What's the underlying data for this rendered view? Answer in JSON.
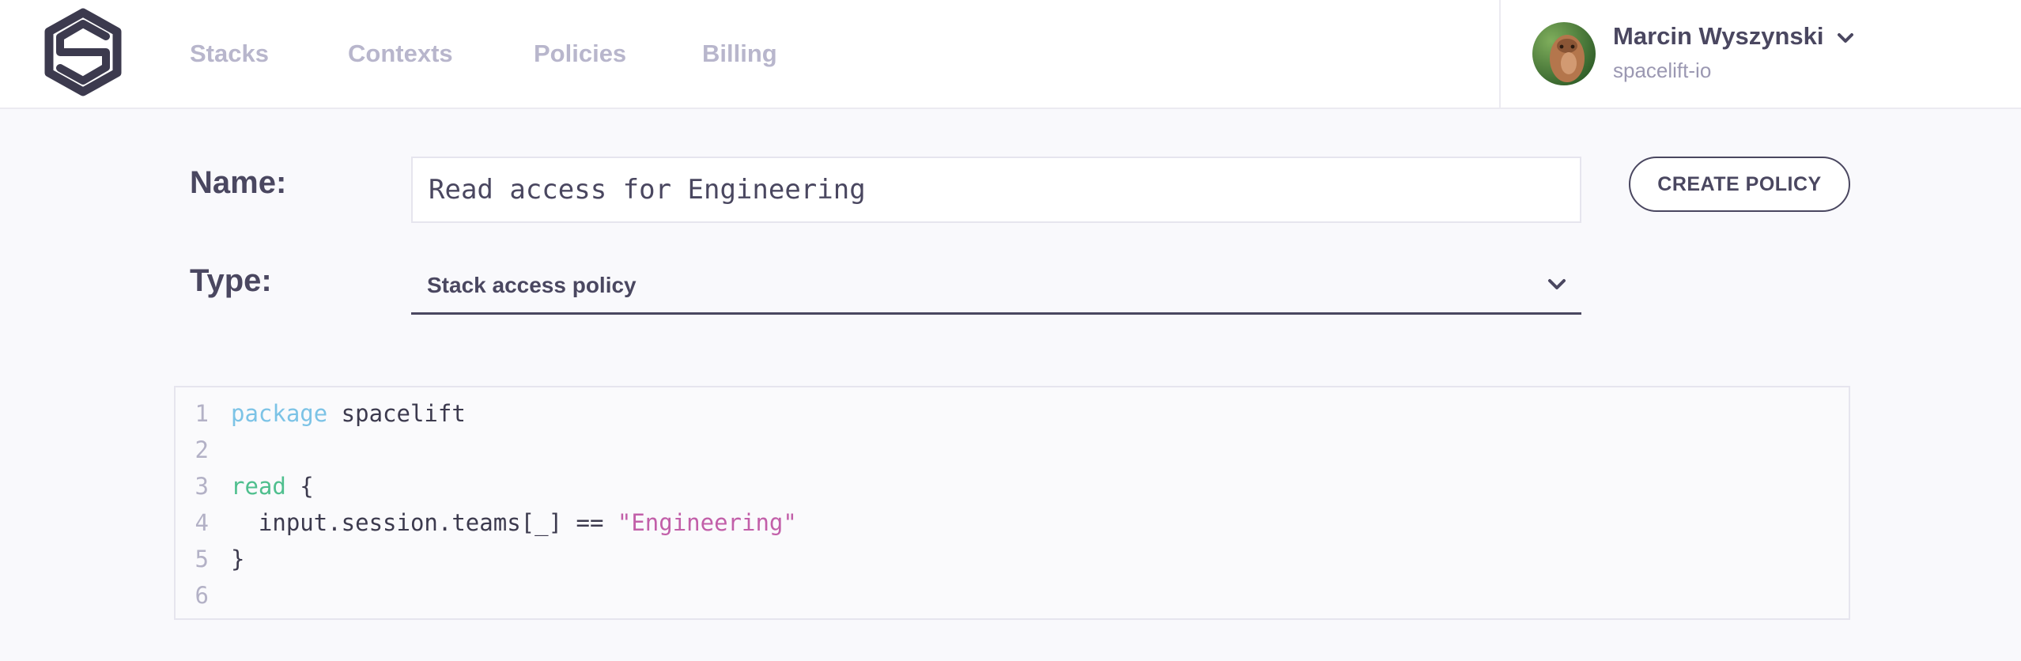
{
  "nav": {
    "items": [
      {
        "label": "Stacks"
      },
      {
        "label": "Contexts"
      },
      {
        "label": "Policies"
      },
      {
        "label": "Billing"
      }
    ]
  },
  "user": {
    "name": "Marcin Wyszynski",
    "org": "spacelift-io"
  },
  "form": {
    "name_label": "Name:",
    "name_value": "Read access for Engineering",
    "type_label": "Type:",
    "type_value": "Stack access policy",
    "create_button": "CREATE POLICY"
  },
  "editor": {
    "lines": [
      {
        "number": "1",
        "tokens": [
          {
            "t": "package",
            "k": "keyword"
          },
          {
            "t": " spacelift",
            "k": "plain"
          }
        ]
      },
      {
        "number": "2",
        "tokens": []
      },
      {
        "number": "3",
        "tokens": [
          {
            "t": "read",
            "k": "rule"
          },
          {
            "t": " {",
            "k": "plain"
          }
        ]
      },
      {
        "number": "4",
        "tokens": [
          {
            "t": "  input.session.teams[_] == ",
            "k": "plain"
          },
          {
            "t": "\"Engineering\"",
            "k": "string"
          }
        ]
      },
      {
        "number": "5",
        "tokens": [
          {
            "t": "}",
            "k": "plain"
          }
        ]
      },
      {
        "number": "6",
        "tokens": []
      }
    ]
  },
  "colors": {
    "text": "#4a4760",
    "nav_muted": "#b8b6cc",
    "keyword": "#7cc3e6",
    "rule": "#4fbf8e",
    "string": "#c25fa9",
    "background": "#f9f9fc"
  },
  "icons": {
    "logo": "spacelift-logo",
    "user_menu": "chevron-down-icon",
    "select": "chevron-down-icon"
  }
}
